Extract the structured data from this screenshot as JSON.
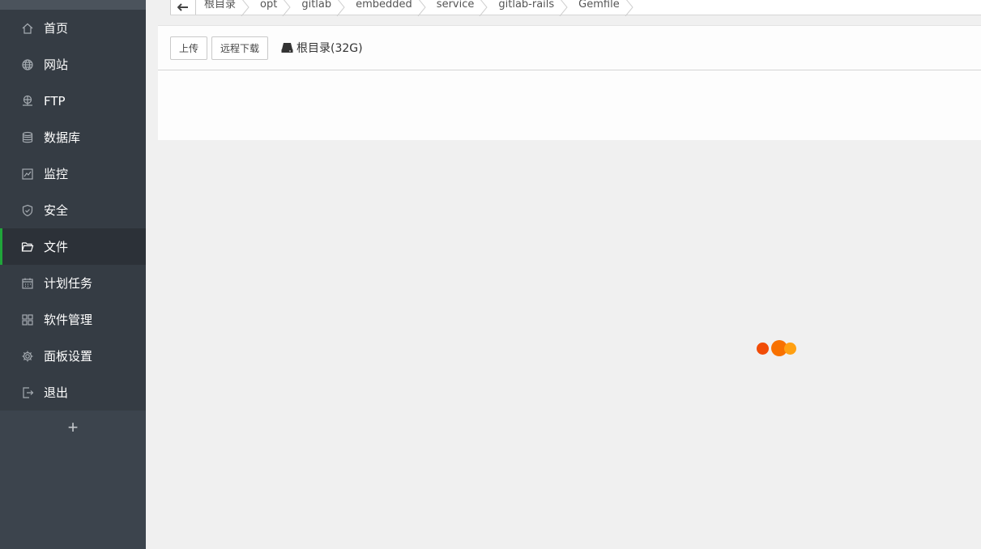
{
  "sidebar": {
    "items": [
      {
        "label": "首页",
        "icon": "home-icon"
      },
      {
        "label": "网站",
        "icon": "globe-icon"
      },
      {
        "label": "FTP",
        "icon": "ftp-icon"
      },
      {
        "label": "数据库",
        "icon": "database-icon"
      },
      {
        "label": "监控",
        "icon": "monitor-icon"
      },
      {
        "label": "安全",
        "icon": "shield-icon"
      },
      {
        "label": "文件",
        "icon": "folder-icon",
        "active": true
      },
      {
        "label": "计划任务",
        "icon": "calendar-icon"
      },
      {
        "label": "软件管理",
        "icon": "apps-grid-icon"
      },
      {
        "label": "面板设置",
        "icon": "gear-icon"
      },
      {
        "label": "退出",
        "icon": "logout-icon"
      }
    ],
    "add_label": "+"
  },
  "breadcrumb": {
    "back_icon": "arrow-left-icon",
    "items": [
      "根目录",
      "opt",
      "gitlab",
      "embedded",
      "service",
      "gitlab-rails",
      "Gemfile"
    ]
  },
  "toolbar": {
    "upload_label": "上传",
    "remote_download_label": "远程下载",
    "disk_label": "根目录(32G)",
    "disk_icon": "hard-drive-icon"
  },
  "colors": {
    "sidebar_bg": "#3c444d",
    "active_accent": "#20a53a",
    "loader_dots": [
      "#f14c07",
      "#f87100",
      "#ffa012"
    ]
  }
}
